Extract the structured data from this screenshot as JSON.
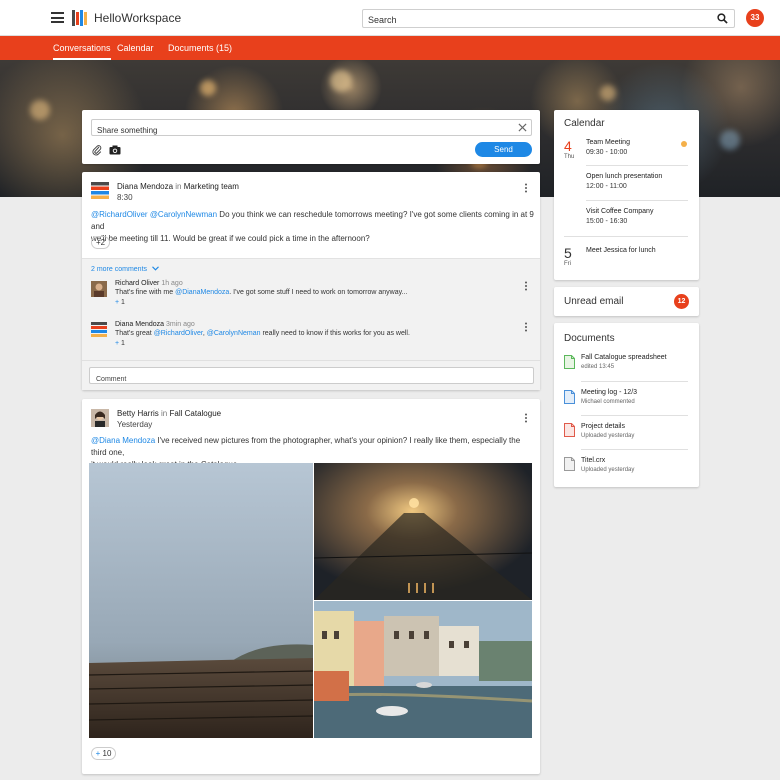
{
  "app": {
    "title": "HelloWorkspace",
    "user_badge": "33"
  },
  "search": {
    "placeholder": "Search"
  },
  "tabs": [
    {
      "label": "Conversations",
      "active": true
    },
    {
      "label": "Calendar",
      "active": false
    },
    {
      "label": "Documents (15)",
      "active": false
    }
  ],
  "share": {
    "placeholder": "Share something",
    "send_label": "Send"
  },
  "post1": {
    "author": "Diana Mendoza",
    "in_word": "in",
    "group": "Marketing team",
    "time": "8:30",
    "mention1": "@RichardOliver",
    "mention2": "@CarolynNewman",
    "text_line1": " Do you think we can reschedule tomorrows meeting? I've got some clients coming in at 9 and",
    "text_line2": "we'll be meeting till 11.  Would be great if we could pick a time in the afternoon?",
    "plus_label": "+2",
    "more_comments": "2 more comments",
    "comments": [
      {
        "author": "Richard Oliver",
        "time": "1h ago",
        "text_before": "That's fine with me ",
        "mention": "@DianaMendoza",
        "text_after": ". I've got some stuff I need to work on tomorrow anyway...",
        "plus": "+",
        "count": "1"
      },
      {
        "author": "Diana Mendoza",
        "time": "3min ago",
        "text_before": "That's great ",
        "mention": "@RichardOliver",
        "mention2": "@CarolynNeman",
        "sep": ", ",
        "text_after": " really need to know if this works for you as well.",
        "plus": "+",
        "count": "1"
      }
    ],
    "comment_placeholder": "Comment"
  },
  "post2": {
    "author": "Betty Harris",
    "in_word": "in",
    "group": "Fall Catalogue",
    "time": "Yesterday",
    "mention": "@Diana Mendoza",
    "text_line1": " I've received new pictures from the photographer, what's your opinion? I really like them, especially the third one,",
    "text_line2": "it would really look great in the Catalogue.",
    "plus": "+",
    "count": "10"
  },
  "calendar": {
    "title": "Calendar",
    "days": [
      {
        "day": "4",
        "dow": "Thu",
        "color": "#e8401c"
      },
      {
        "day": "5",
        "dow": "Fri",
        "color": "#333333"
      }
    ],
    "events": [
      {
        "title": "Team Meeting",
        "time": "09:30 - 10:00"
      },
      {
        "title": "Open lunch presentation",
        "time": "12:00 - 11:00"
      },
      {
        "title": "Visit Coffee Company",
        "time": "15:00 - 16:30"
      },
      {
        "title": "Meet Jessica for lunch",
        "time": ""
      }
    ]
  },
  "unread": {
    "label": "Unread email",
    "count": "12"
  },
  "documents": {
    "title": "Documents",
    "items": [
      {
        "name": "Fall Catalogue spreadsheet",
        "sub": "edited 13:45",
        "color": "#5cb85c",
        "icon": "spreadsheet-icon"
      },
      {
        "name": "Meeting log - 12/3",
        "sub": "Michael commented",
        "color": "#4a90d9",
        "icon": "document-icon"
      },
      {
        "name": "Project details",
        "sub": "Uploaded yesterday",
        "color": "#e05a4a",
        "icon": "pdf-icon"
      },
      {
        "name": "Titel.crx",
        "sub": "Uploaded yesterday",
        "color": "#9a9a9a",
        "icon": "file-icon"
      }
    ]
  },
  "colors": {
    "accent": "#e8401c",
    "link": "#1e88e5",
    "event_dot": "#f4b04a"
  }
}
